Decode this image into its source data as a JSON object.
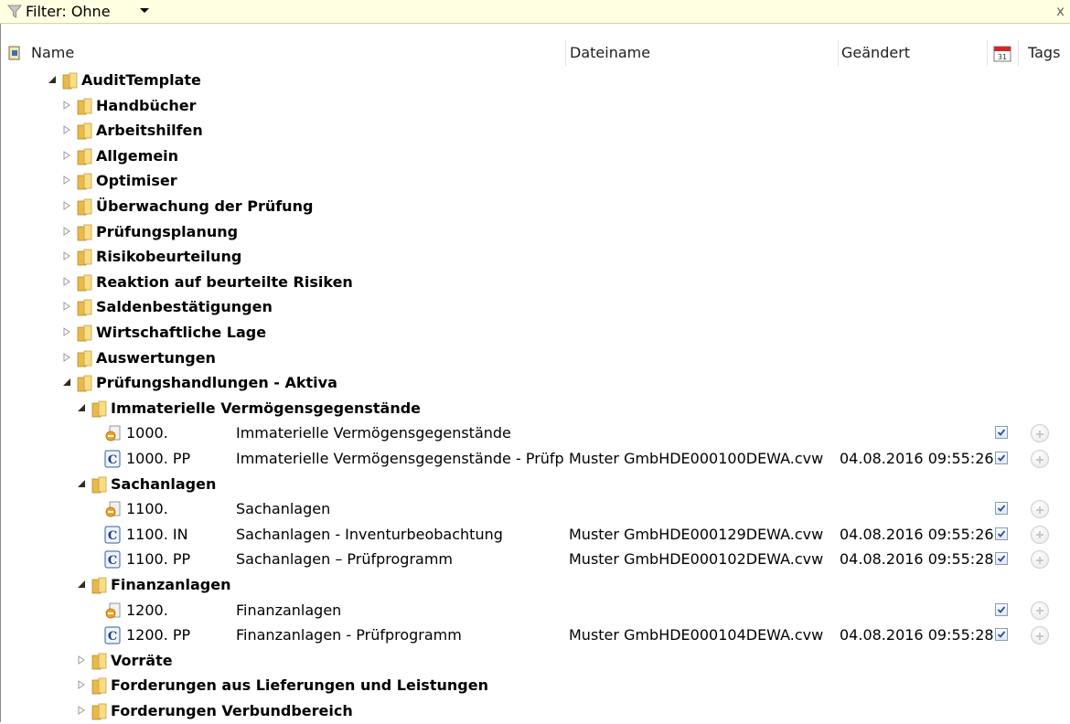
{
  "filter": {
    "label": "Filter: Ohne",
    "close": "x"
  },
  "columns": {
    "name": "Name",
    "filename": "Dateiname",
    "changed": "Geändert",
    "tags": "Tags"
  },
  "rows": [
    {
      "level": 0,
      "expanded": true,
      "type": "folder",
      "name": "AuditTemplate"
    },
    {
      "level": 1,
      "expanded": false,
      "type": "folder",
      "name": "Handbücher"
    },
    {
      "level": 1,
      "expanded": false,
      "type": "folder",
      "name": "Arbeitshilfen"
    },
    {
      "level": 1,
      "expanded": false,
      "type": "folder",
      "name": "Allgemein"
    },
    {
      "level": 1,
      "expanded": false,
      "type": "folder",
      "name": "Optimiser"
    },
    {
      "level": 1,
      "expanded": false,
      "type": "folder",
      "name": "Überwachung der Prüfung"
    },
    {
      "level": 1,
      "expanded": false,
      "type": "folder",
      "name": "Prüfungsplanung"
    },
    {
      "level": 1,
      "expanded": false,
      "type": "folder",
      "name": "Risikobeurteilung"
    },
    {
      "level": 1,
      "expanded": false,
      "type": "folder",
      "name": "Reaktion auf beurteilte Risiken"
    },
    {
      "level": 1,
      "expanded": false,
      "type": "folder",
      "name": "Saldenbestätigungen"
    },
    {
      "level": 1,
      "expanded": false,
      "type": "folder",
      "name": "Wirtschaftliche Lage"
    },
    {
      "level": 1,
      "expanded": false,
      "type": "folder",
      "name": "Auswertungen"
    },
    {
      "level": 1,
      "expanded": true,
      "type": "folder",
      "name": "Prüfungshandlungen - Aktiva"
    },
    {
      "level": 2,
      "expanded": true,
      "type": "folder",
      "name": "Immaterielle Vermögensgegenstände"
    },
    {
      "level": 3,
      "type": "doc",
      "name": "1000.",
      "description": "Immaterielle Vermögensgegenstände",
      "filename": "",
      "changed": "",
      "checked": true
    },
    {
      "level": 3,
      "type": "c",
      "name": "1000. PP",
      "description": "Immaterielle Vermögensgegenstände - Prüfprogramm",
      "filename": "Muster GmbHDE000100DEWA.cvw",
      "changed": "04.08.2016 09:55:26",
      "checked": true
    },
    {
      "level": 2,
      "expanded": true,
      "type": "folder",
      "name": "Sachanlagen"
    },
    {
      "level": 3,
      "type": "doc",
      "name": "1100.",
      "description": "Sachanlagen",
      "filename": "",
      "changed": "",
      "checked": true
    },
    {
      "level": 3,
      "type": "c",
      "name": "1100. IN",
      "description": "Sachanlagen - Inventurbeobachtung",
      "filename": "Muster GmbHDE000129DEWA.cvw",
      "changed": "04.08.2016 09:55:26",
      "checked": true
    },
    {
      "level": 3,
      "type": "c",
      "name": "1100. PP",
      "description": "Sachanlagen – Prüfprogramm",
      "filename": "Muster GmbHDE000102DEWA.cvw",
      "changed": "04.08.2016 09:55:28",
      "checked": true
    },
    {
      "level": 2,
      "expanded": true,
      "type": "folder",
      "name": "Finanzanlagen"
    },
    {
      "level": 3,
      "type": "doc",
      "name": "1200.",
      "description": "Finanzanlagen",
      "filename": "",
      "changed": "",
      "checked": true
    },
    {
      "level": 3,
      "type": "c",
      "name": "1200. PP",
      "description": "Finanzanlagen - Prüfprogramm",
      "filename": "Muster GmbHDE000104DEWA.cvw",
      "changed": "04.08.2016 09:55:28",
      "checked": true
    },
    {
      "level": 2,
      "expanded": false,
      "type": "folder",
      "name": "Vorräte"
    },
    {
      "level": 2,
      "expanded": false,
      "type": "folder",
      "name": "Forderungen aus Lieferungen und Leistungen"
    },
    {
      "level": 2,
      "expanded": false,
      "type": "folder",
      "name": "Forderungen Verbundbereich"
    }
  ]
}
